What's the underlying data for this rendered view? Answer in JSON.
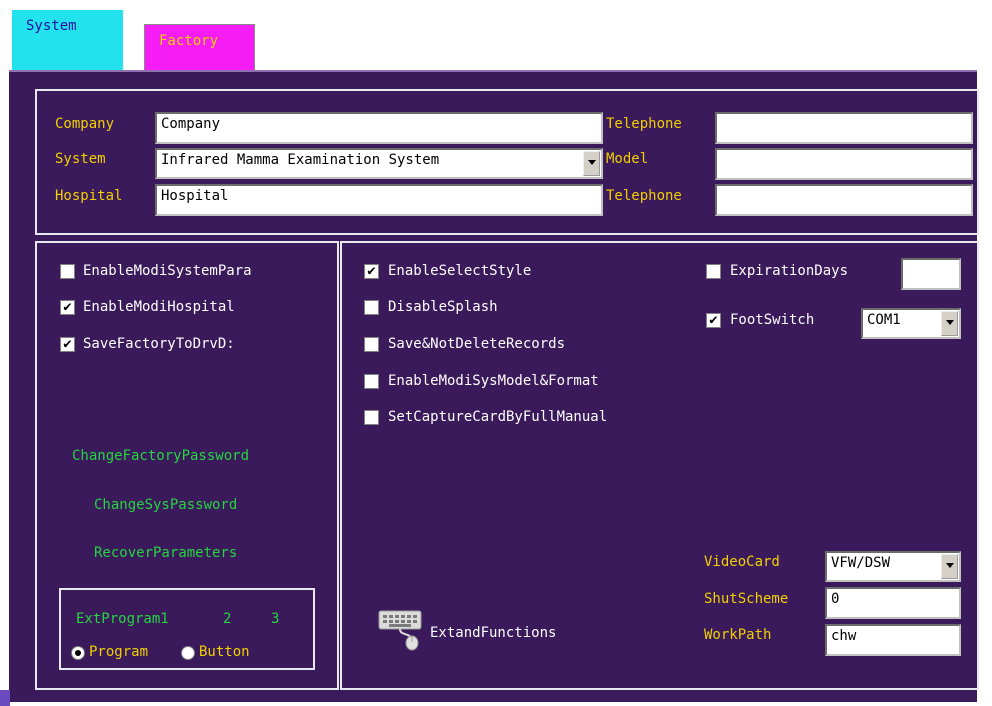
{
  "tabs": {
    "system": "System",
    "factory": "Factory"
  },
  "info": {
    "company_label": "Company",
    "company_value": "Company",
    "system_label": "System",
    "system_value": "Infrared Mamma Examination System",
    "hospital_label": "Hospital",
    "hospital_value": "Hospital",
    "telephone1_label": "Telephone",
    "telephone1_value": "",
    "model_label": "Model",
    "model_value": "",
    "telephone2_label": "Telephone",
    "telephone2_value": ""
  },
  "left": {
    "checkboxes": [
      {
        "label": "EnableModiSystemPara",
        "checked": false
      },
      {
        "label": "EnableModiHospital",
        "checked": true
      },
      {
        "label": "SaveFactoryToDrvD:",
        "checked": true
      }
    ],
    "links": [
      "ChangeFactoryPassword",
      "ChangeSysPassword",
      "RecoverParameters"
    ],
    "ext": {
      "program1": "ExtProgram1",
      "program2": "2",
      "program3": "3",
      "radio_program": "Program",
      "radio_button": "Button",
      "selected": "Program"
    }
  },
  "right": {
    "checkboxes": [
      {
        "label": "EnableSelectStyle",
        "checked": true
      },
      {
        "label": "DisableSplash",
        "checked": false
      },
      {
        "label": "Save&NotDeleteRecords",
        "checked": false
      },
      {
        "label": "EnableModiSysModel&Format",
        "checked": false
      },
      {
        "label": "SetCaptureCardByFullManual",
        "checked": false
      }
    ],
    "expiration_label": "ExpirationDays",
    "expiration_checked": false,
    "expiration_value": "",
    "footswitch_label": "FootSwitch",
    "footswitch_checked": true,
    "footswitch_port": "COM1",
    "videocard_label": "VideoCard",
    "videocard_value": "VFW/DSW",
    "shutscheme_label": "ShutScheme",
    "shutscheme_value": "0",
    "workpath_label": "WorkPath",
    "workpath_value": "chw",
    "extand_label": "ExtandFunctions",
    "extand_icon": "keyboard-icon"
  },
  "colors": {
    "panel_bg": "#3a1a5a",
    "label_yellow": "#f0d000",
    "link_green": "#25d540",
    "tab_system": "#22e2ee",
    "tab_factory": "#f51cf5"
  }
}
